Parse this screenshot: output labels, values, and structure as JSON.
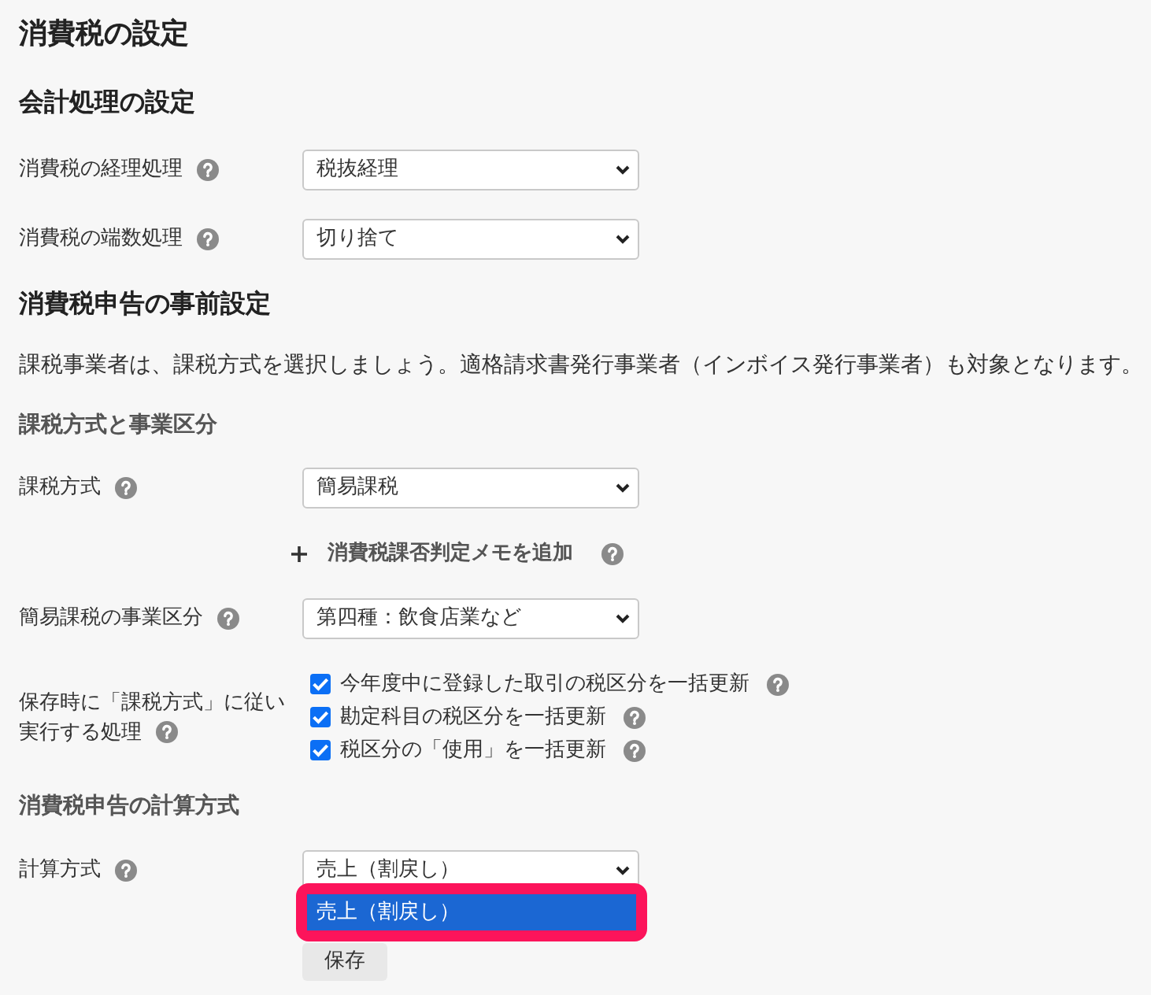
{
  "title": "消費税の設定",
  "accounting": {
    "heading": "会計処理の設定",
    "fields": [
      {
        "label": "消費税の経理処理",
        "value": "税抜経理"
      },
      {
        "label": "消費税の端数処理",
        "value": "切り捨て"
      }
    ]
  },
  "filing_prep": {
    "heading": "消費税申告の事前設定",
    "note": "課税事業者は、課税方式を選択しましょう。適格請求書発行事業者（インボイス発行事業者）も対象となります。",
    "subheading": "課税方式と事業区分",
    "tax_method": {
      "label": "課税方式",
      "value": "簡易課税"
    },
    "add_memo_link": "消費税課否判定メモを追加",
    "business_category": {
      "label": "簡易課税の事業区分",
      "value": "第四種：飲食店業など"
    },
    "on_save": {
      "label_lines": [
        "保存時に「課税方式」に従い",
        "実行する処理"
      ],
      "options": [
        {
          "label": "今年度中に登録した取引の税区分を一括更新",
          "checked": true
        },
        {
          "label": "勘定科目の税区分を一括更新",
          "checked": true
        },
        {
          "label": "税区分の「使用」を一括更新",
          "checked": true
        }
      ]
    }
  },
  "calculation": {
    "subheading": "消費税申告の計算方式",
    "field": {
      "label": "計算方式",
      "value": "売上（割戻し）",
      "open_options": [
        {
          "label": "売上（割戻し）",
          "selected": true
        }
      ]
    }
  },
  "save_button": "保存"
}
